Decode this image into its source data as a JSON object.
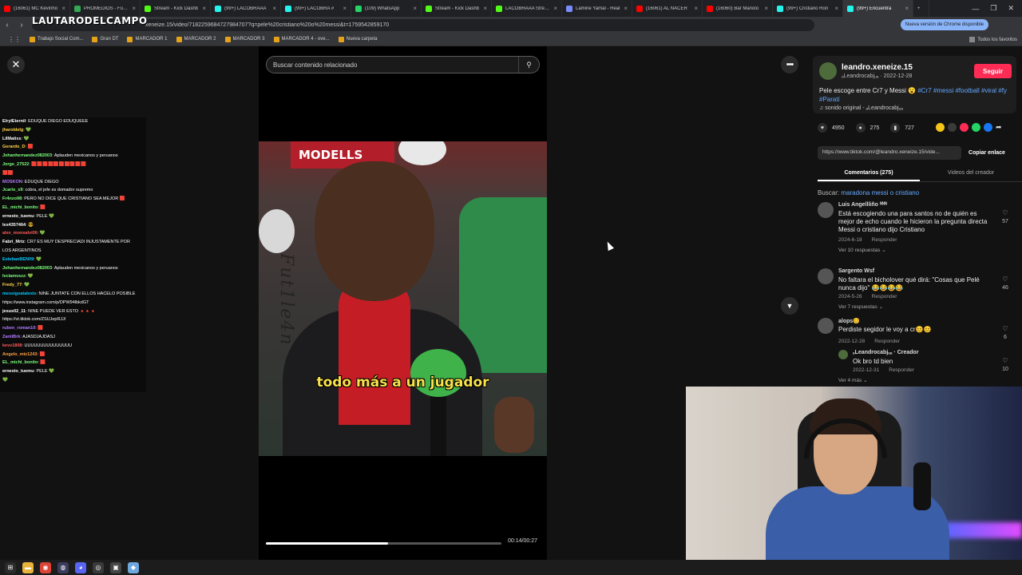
{
  "browser": {
    "tabs": [
      {
        "title": "(16061) MC Kevinho",
        "color": "#ff0000",
        "active": false
      },
      {
        "title": "PROMEDIOS - Fútbol",
        "color": "#34a853",
        "active": false
      },
      {
        "title": "Stream - Kick Dashb",
        "color": "#53fc18",
        "active": false
      },
      {
        "title": "(99+) LACOBRAAA",
        "color": "#25f4ee",
        "active": false
      },
      {
        "title": "(99+) LACOBRA #",
        "color": "#25f4ee",
        "active": false
      },
      {
        "title": "(109) WhatsApp",
        "color": "#25d366",
        "active": false
      },
      {
        "title": "Stream - Kick Dashb",
        "color": "#53fc18",
        "active": false
      },
      {
        "title": "LACOBRAAA Stream",
        "color": "#53fc18",
        "active": false
      },
      {
        "title": "Lamine Yamal - Real",
        "color": "#7b8cff",
        "active": false
      },
      {
        "title": "(16061) AL NACER",
        "color": "#ff0000",
        "active": false
      },
      {
        "title": "(16060) Bar Manolo",
        "color": "#ff0000",
        "active": false
      },
      {
        "title": "(99+) Cristiano Ron",
        "color": "#25f4ee",
        "active": false
      },
      {
        "title": "(99+) Encuentra",
        "color": "#25f4ee",
        "active": true
      }
    ],
    "new_tab": "+",
    "window_controls": [
      "—",
      "❐",
      "✕"
    ],
    "url": "xeneize.15/video/7182259684727984707?q=pele%20cristiano%20o%20messi&t=1759542859170",
    "watermark_logo": "LAUTARODELCAMPO",
    "update_label": "Nueva versión de Chrome disponible",
    "bookmarks": [
      "Trabajo Social Com...",
      "Gran DT",
      "MARCADOR 1",
      "MARCADOR 2",
      "MARCADOR 3",
      "MARCADOR 4 - ove...",
      "Nueva carpeta"
    ],
    "all_bookmarks": "Todos los favoritos"
  },
  "player": {
    "search_placeholder": "Buscar contenido relacionado",
    "caption": "todo más a un jugador",
    "sign_text": "MODELLS",
    "watermark": "Fut1le4n",
    "time": "00:14/00:27",
    "progress": 0.52
  },
  "post": {
    "username": "leandro.xeneize.15",
    "handle_date": "ₐLeandrocabjᵤₐ · 2022-12-28",
    "follow_label": "Seguir",
    "desc_text": "Pele escoge entre Cr7 y Messi 😮",
    "desc_tags": "#Cr7 #messi #football #viral #fy #Paratí",
    "music": "♫  sonido original - ₐLeandrocabjᵤₐ",
    "likes": "4950",
    "comments": "275",
    "saves": "727",
    "link": "https://www.tiktok.com/@leandro.xeneize.15/vide...",
    "copy_label": "Copiar enlace",
    "tab_comments": "Comentarios (275)",
    "tab_videos": "Videos del creador",
    "search_prefix": "Buscar:",
    "search_query": "maradona messi o cristiano",
    "share_colors": [
      "#f5c518",
      "#3a3a3a",
      "#fe2c55",
      "#25d366",
      "#1877f2"
    ]
  },
  "comments": [
    {
      "name": "Luis Angellliño ᴺᴺᴺ",
      "text": "Está escogiendo una para santos no de quién es mejor de echo cuando le hicieron la pregunta directa Messi o cristiano dijo Cristiano",
      "date": "2024-6-18",
      "reply": "Responder",
      "views": "Ver 10 respuestas ⌄",
      "likes": "57"
    },
    {
      "name": "Sargento Wsf",
      "text": "No faltara el bicholover qué dirá: \"Cosas que Pelé nunca dijo\" 😂😂😂😂",
      "date": "2024-5-26",
      "reply": "Responder",
      "views": "Ver 7 respuestas ⌄",
      "likes": "46"
    },
    {
      "name": "alops😊",
      "text": "Perdiste segidor le voy a cr😊😊",
      "date": "2022-12-28",
      "reply": "Responder",
      "views": "",
      "likes": "6"
    },
    {
      "name": "ₐLeandrocabjᵤₐ · Creador",
      "text": "Ok bro td bien",
      "date": "2022-12-31",
      "reply": "Responder",
      "views": "Ver 4 más ⌄",
      "likes": "10"
    }
  ],
  "chat": [
    {
      "user": "ElrylEternil",
      "msg": ": EDUQUE DIEGO EDUQUEEE",
      "color": "#ffffff"
    },
    {
      "user": "jharoldelg",
      "msg": ": 💚",
      "color": "#ffd54a"
    },
    {
      "user": "LilMatixs",
      "msg": ": 💚",
      "color": "#ffffff"
    },
    {
      "user": "Gerardo_D",
      "msg": ": 🟥",
      "color": "#ffd54a"
    },
    {
      "user": "Johanhernandez082003",
      "msg": ": Aplauden mexicanos y peruanos",
      "color": "#7cff7c"
    },
    {
      "user": "Jorge_27522",
      "msg": ": 🟥🟥🟥🟥🟥🟥🟥🟥🟥🟥",
      "color": "#7cff7c"
    },
    {
      "user": "",
      "msg": "🟥🟥",
      "color": "#ffffff"
    },
    {
      "user": "MOSKON",
      "msg": ": EDUQUE DIEGO",
      "color": "#b57cff"
    },
    {
      "user": "Jcarlo_x9",
      "msg": ": cobra, el jefe es domador supremo",
      "color": "#7cff7c"
    },
    {
      "user": "Fr4nzo98",
      "msg": ": PERO NO DICE QUE CRISTIANO SEA MEJOR 🟥",
      "color": "#7cff7c"
    },
    {
      "user": "EL_michi_bonito",
      "msg": ": 🟥",
      "color": "#7cff7c"
    },
    {
      "user": "ernesto_tuemu",
      "msg": ": PELE 💚",
      "color": "#ffffff"
    },
    {
      "user": "lex4357464",
      "msg": ": 😎",
      "color": "#ffffff"
    },
    {
      "user": "alex_monsalvi06",
      "msg": ": 💚",
      "color": "#ff5a5a"
    },
    {
      "user": "Fabri_Mrtz",
      "msg": ": CR7 ES MUY DESPRECIADI INJUSTAMENTE POR",
      "color": "#ffffff"
    },
    {
      "user": "",
      "msg": "LOS ARGENTINOS",
      "color": "#ffffff"
    },
    {
      "user": "EstebanBEN09",
      "msg": ": 💚",
      "color": "#00c8ff"
    },
    {
      "user": "Johanhernandez082003",
      "msg": ": Aplauden mexicanos y peruanos",
      "color": "#7cff7c"
    },
    {
      "user": "lvciamvszz",
      "msg": ": 💚",
      "color": "#7cff7c"
    },
    {
      "user": "Fredy_77",
      "msg": ": 💚",
      "color": "#ffd54a"
    },
    {
      "user": "messigoatalexis",
      "msg": ": NINE JUNTATE CON ELLOS HACELO POSIBLE",
      "color": "#00c8ff"
    },
    {
      "user": "",
      "msg": "https://www.instagram.com/p/DPW94lbkdGT",
      "color": "#ffffff"
    },
    {
      "user": "jesus02_11",
      "msg": ": NINE PUEDE VER ESTO 🔺🔺🔺",
      "color": "#ffffff"
    },
    {
      "user": "",
      "msg": "https://vt.tiktok.com/ZSUJepRJJ/",
      "color": "#ffffff"
    },
    {
      "user": "ruben_roman10",
      "msg": ": 🟥",
      "color": "#b57cff"
    },
    {
      "user": "ZantiBrk",
      "msg": ": AJASDJAJDASJ",
      "color": "#b57cff"
    },
    {
      "user": "kevv1808",
      "msg": ": UUUUUUUUUUUUUUU",
      "color": "#ff5a5a"
    },
    {
      "user": "Angelo_mtz1243",
      "msg": ": 🟥",
      "color": "#ff9f43"
    },
    {
      "user": "EL_michi_bonito",
      "msg": ": 🟥",
      "color": "#7cff7c"
    },
    {
      "user": "ernesto_tuemu",
      "msg": ": PELE 💚",
      "color": "#ffffff"
    },
    {
      "user": "",
      "msg": "💚",
      "color": "#ffffff"
    }
  ],
  "taskbar": [
    {
      "icon": "windows-icon",
      "glyph": "⊞",
      "color": "#2b2b2b"
    },
    {
      "icon": "folder-icon",
      "glyph": "▬",
      "color": "#e8b339"
    },
    {
      "icon": "chrome-icon",
      "glyph": "◉",
      "color": "#db4437"
    },
    {
      "icon": "app-icon",
      "glyph": "◍",
      "color": "#3b3b5c"
    },
    {
      "icon": "discord-icon",
      "glyph": "◕",
      "color": "#5865f2"
    },
    {
      "icon": "obs-icon",
      "glyph": "◎",
      "color": "#3a3a3a"
    },
    {
      "icon": "terminal-icon",
      "glyph": "▣",
      "color": "#444"
    },
    {
      "icon": "notes-icon",
      "glyph": "◆",
      "color": "#6fa8dc"
    }
  ]
}
